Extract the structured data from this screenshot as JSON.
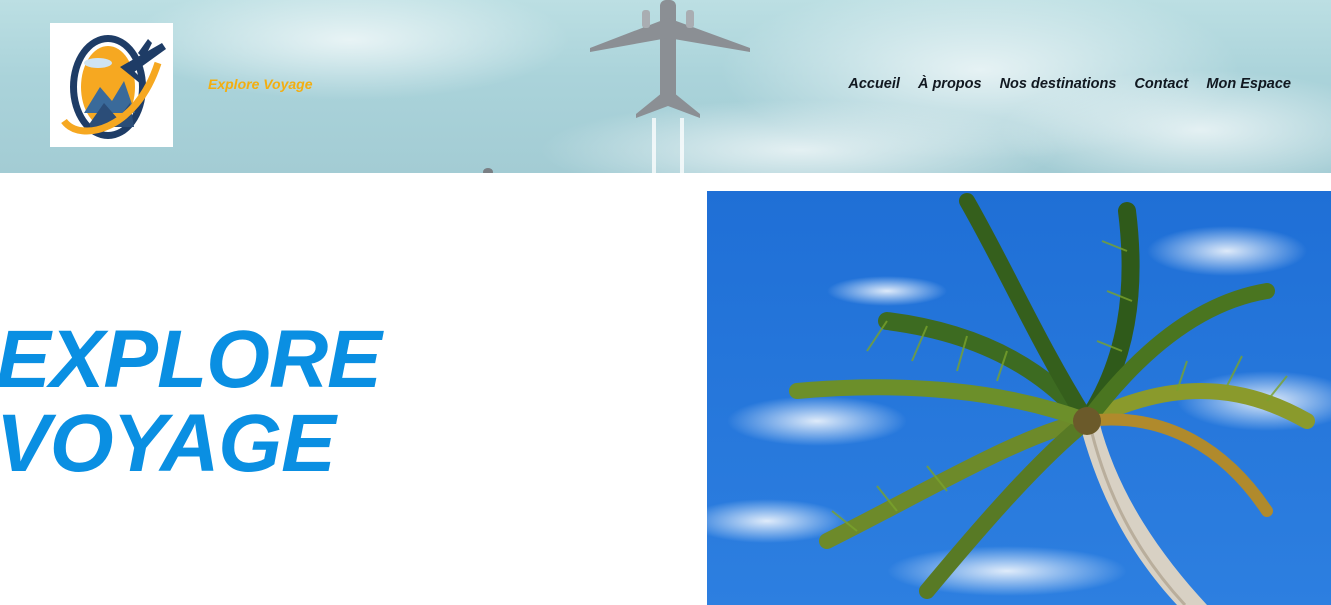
{
  "header": {
    "brand": "Explore Voyage",
    "logo_icon": "travel-plane-logo-icon",
    "background_icon": "airplane-sky-background",
    "nav": [
      {
        "label": "Accueil"
      },
      {
        "label": "À propos"
      },
      {
        "label": "Nos destinations"
      },
      {
        "label": "Contact"
      },
      {
        "label": "Mon Espace"
      }
    ]
  },
  "hero": {
    "title_line1": "EXPLORE",
    "title_line2": "VOYAGE",
    "image_icon": "palm-tree-photo"
  },
  "colors": {
    "brand_text": "#f3ae10",
    "hero_title": "#0a8fe2",
    "nav_text": "#111820"
  }
}
